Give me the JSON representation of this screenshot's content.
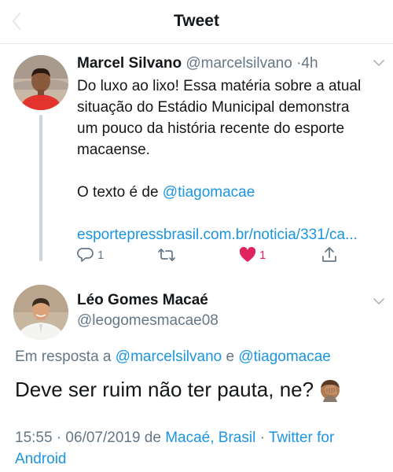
{
  "header": {
    "title": "Tweet",
    "back_icon": "chevron-left-icon"
  },
  "parent_tweet": {
    "author_name": "Marcel Silvano",
    "author_handle": "@marcelsilvano",
    "separator": "·",
    "time": "4h",
    "text_line1": "Do luxo ao lixo! Essa matéria sobre a atual",
    "text_line2": "situação do Estádio Municipal demonstra",
    "text_line3": "um pouco da história recente do esporte",
    "text_line4": "macaense.",
    "credit_prefix": "O texto é de ",
    "credit_mention": "@tiagomacae",
    "link": "esportepressbrasil.com.br/noticia/331/ca...",
    "reply_count": "1",
    "retweet_count": "",
    "like_count": "1",
    "like_color": "#e0245e",
    "link_color": "#1b95e0"
  },
  "main_tweet": {
    "author_name": "Léo Gomes Macaé",
    "author_handle": "@leogomesmacae08",
    "reply_prefix": "Em resposta a ",
    "reply_mention1": "@marcelsilvano",
    "reply_joiner": " e ",
    "reply_mention2": "@tiagomacae",
    "text": "Deve ser ruim não ter pauta, ne?",
    "emoji": "facepalm-emoji",
    "time": "15:55 · 06/07/2019 de ",
    "location": "Macaé, Brasil",
    "dot": " · ",
    "client": "Twitter for Android"
  }
}
